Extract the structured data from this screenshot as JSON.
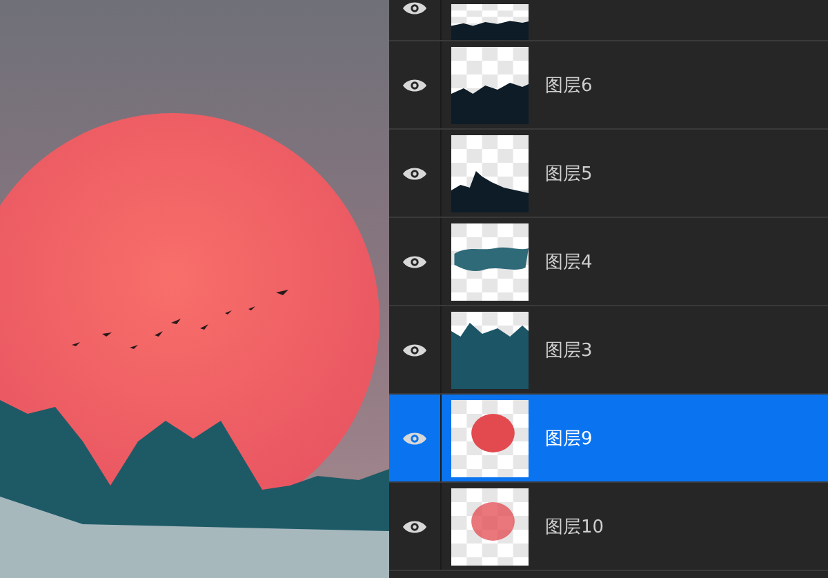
{
  "layers_panel": {
    "layers": [
      {
        "kind": "mountain",
        "visible": true,
        "selected": false
      },
      {
        "label": "图层6",
        "kind": "mountain",
        "visible": true,
        "selected": false
      },
      {
        "label": "图层5",
        "kind": "peak",
        "visible": true,
        "selected": false
      },
      {
        "label": "图层4",
        "kind": "mist",
        "visible": true,
        "selected": false
      },
      {
        "label": "图层3",
        "kind": "teal",
        "visible": true,
        "selected": false
      },
      {
        "label": "图层9",
        "kind": "sun",
        "visible": true,
        "selected": true
      },
      {
        "label": "图层10",
        "kind": "glow",
        "visible": true,
        "selected": false
      }
    ]
  }
}
